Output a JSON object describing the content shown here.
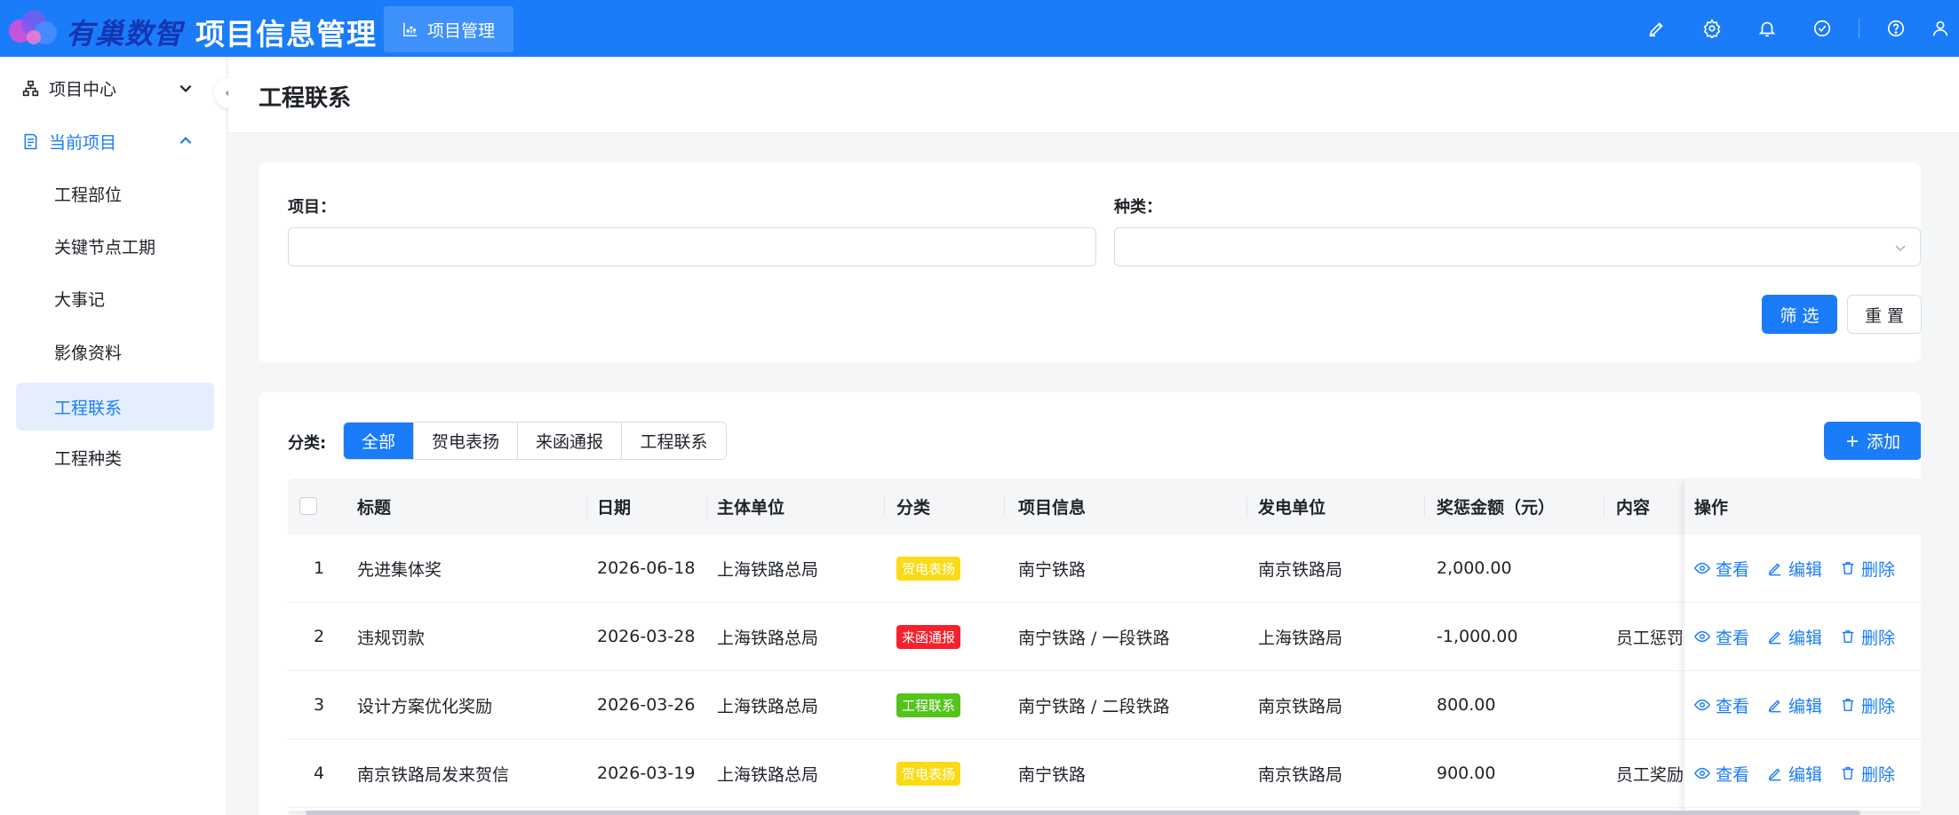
{
  "header": {
    "logo_text": "有巢数智",
    "app_title": "项目信息管理",
    "active_tab": "项目管理",
    "icons": [
      "pen-icon",
      "settings-icon",
      "bell-icon",
      "check-circle-icon",
      "help-icon",
      "user-icon"
    ]
  },
  "sidebar": {
    "group_project_center": "项目中心",
    "group_current_project": "当前项目",
    "items": [
      {
        "label": "工程部位"
      },
      {
        "label": "关键节点工期"
      },
      {
        "label": "大事记"
      },
      {
        "label": "影像资料"
      },
      {
        "label": "工程联系"
      },
      {
        "label": "工程种类"
      }
    ],
    "active_item": "工程联系"
  },
  "page": {
    "title": "工程联系"
  },
  "filter": {
    "project_label": "项目：",
    "project_value": "",
    "type_label": "种类：",
    "type_value": "",
    "filter_button": "筛 选",
    "reset_button": "重 置"
  },
  "list": {
    "category_label": "分类:",
    "segments": [
      "全部",
      "贺电表扬",
      "来函通报",
      "工程联系"
    ],
    "add_button": "添加",
    "columns": [
      "标题",
      "日期",
      "主体单位",
      "分类",
      "项目信息",
      "发电单位",
      "奖惩金额（元）",
      "内容",
      "操作"
    ],
    "rows": [
      {
        "index": "1",
        "title": "先进集体奖",
        "date": "2026-06-18",
        "unit": "上海铁路总局",
        "category": "贺电表扬",
        "project": "南宁铁路",
        "sender": "南京铁路局",
        "amount": "2,000.00",
        "content": ""
      },
      {
        "index": "2",
        "title": "违规罚款",
        "date": "2026-03-28",
        "unit": "上海铁路总局",
        "category": "来函通报",
        "project": "南宁铁路 / 一段铁路",
        "sender": "上海铁路局",
        "amount": "-1,000.00",
        "content": "员工惩罚"
      },
      {
        "index": "3",
        "title": "设计方案优化奖励",
        "date": "2026-03-26",
        "unit": "上海铁路总局",
        "category": "工程联系",
        "project": "南宁铁路 / 二段铁路",
        "sender": "南京铁路局",
        "amount": "800.00",
        "content": ""
      },
      {
        "index": "4",
        "title": "南京铁路局发来贺信",
        "date": "2026-03-19",
        "unit": "上海铁路总局",
        "category": "贺电表扬",
        "project": "南宁铁路",
        "sender": "南京铁路局",
        "amount": "900.00",
        "content": "员工奖励"
      }
    ],
    "actions": {
      "view": "查看",
      "edit": "编辑",
      "delete": "删除"
    }
  },
  "colors": {
    "primary": "#1a7cf9",
    "tag_praise": "#fadb14",
    "tag_notice": "#f5222d",
    "tag_contact": "#52c41a"
  }
}
